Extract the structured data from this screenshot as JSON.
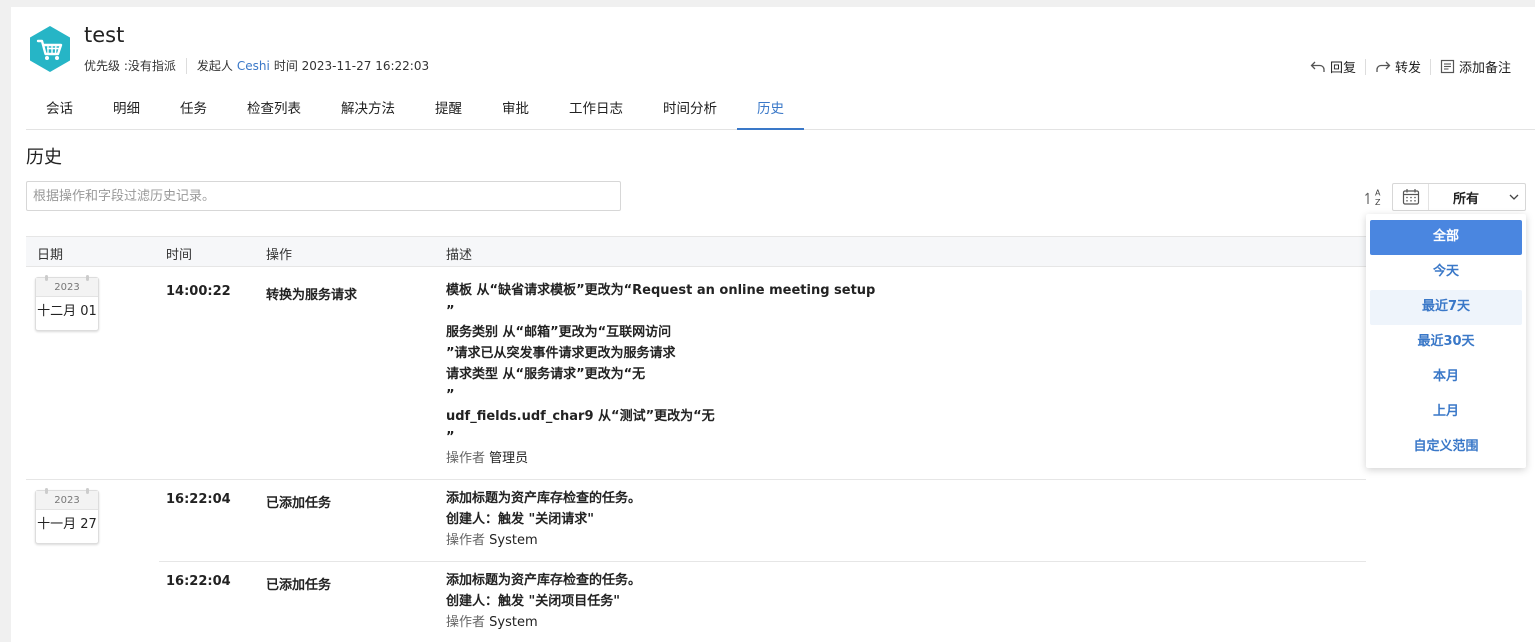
{
  "header": {
    "title": "test",
    "priority": "优先级 :没有指派",
    "requester_label": "发起人",
    "requester_name": "Ceshi",
    "time": "时间 2023-11-27 16:22:03",
    "reply_label": "回复",
    "forward_label": "转发",
    "note_label": "添加备注",
    "brand_color": "#26b5c6"
  },
  "tabs": [
    {
      "label": "会话"
    },
    {
      "label": "明细"
    },
    {
      "label": "任务"
    },
    {
      "label": "检查列表"
    },
    {
      "label": "解决方法"
    },
    {
      "label": "提醒"
    },
    {
      "label": "审批"
    },
    {
      "label": "工作日志"
    },
    {
      "label": "时间分析"
    },
    {
      "label": "历史",
      "active": true
    }
  ],
  "history": {
    "title": "历史",
    "filter_placeholder": "根据操作和字段过滤历史记录。",
    "date_filter_value": "所有",
    "columns": [
      "日期",
      "时间",
      "操作",
      "描述"
    ],
    "rows": [
      {
        "year": "2023",
        "monthday": "十二月 01",
        "time": "14:00:22",
        "action": "转换为服务请求",
        "desc": [
          "模板 从“缺省请求模板”更改为“Request an online meeting setup",
          "”",
          "服务类别 从“邮箱”更改为“互联网访问",
          "”请求已从突发事件请求更改为服务请求",
          "请求类型 从“服务请求”更改为“无",
          "”",
          "udf_fields.udf_char9 从“测试”更改为“无",
          "”"
        ],
        "by_label": "操作者",
        "by": "管理员"
      },
      {
        "year": "2023",
        "monthday": "十一月 27",
        "time": "16:22:04",
        "action": "已添加任务",
        "desc": [
          "添加标题为资产库存检查的任务。",
          "创建人：触发 \"关闭请求\""
        ],
        "by_label": "操作者",
        "by": "System"
      },
      {
        "time": "16:22:04",
        "action": "已添加任务",
        "desc": [
          "添加标题为资产库存检查的任务。",
          "创建人：触发 \"关闭项目任务\""
        ],
        "by_label": "操作者",
        "by": "System"
      }
    ]
  },
  "date_dropdown": {
    "options": [
      "全部",
      "今天",
      "最近7天",
      "最近30天",
      "本月",
      "上月",
      "自定义范围"
    ],
    "selected": "全部",
    "hovered": "最近7天"
  }
}
